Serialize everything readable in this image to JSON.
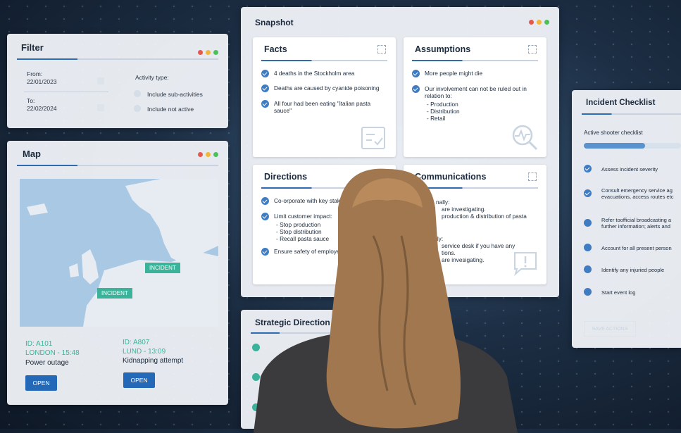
{
  "filter": {
    "title": "Filter",
    "from_label": "From:",
    "from_value": "22/01/2023",
    "to_label": "To:",
    "to_value": "22/02/2024",
    "activity_label": "Activity type:",
    "opt1": "Include sub-activities",
    "opt2": "Include not active"
  },
  "map": {
    "title": "Map",
    "marker1": "INCIDENT",
    "marker2": "INCIDENT",
    "inc1_id": "ID: A101",
    "inc1_loc": "LONDON - 15:48",
    "inc1_type": "Power outage",
    "inc1_btn": "OPEN",
    "inc2_id": "ID: A807",
    "inc2_loc": "LUND - 13:09",
    "inc2_type": "Kidnapping attempt",
    "inc2_btn": "OPEN"
  },
  "snapshot": {
    "title": "Snapshot",
    "facts": {
      "title": "Facts",
      "items": [
        "4 deaths in the Stockholm area",
        "Deaths are caused by cyanide poisoning",
        "All four had been eating \"italian pasta sauce\""
      ]
    },
    "assumptions": {
      "title": "Assumptions",
      "item1": "More people might die",
      "item2": "Our involvement can not be ruled out in relation to:",
      "sub": [
        "-  Production",
        "-  Distribution",
        "-  Retail"
      ]
    },
    "directions": {
      "title": "Directions",
      "item1": "Co-orporate with key stakeh",
      "item2": "Limit customer impact:",
      "sub": [
        "-  Stop production",
        "-  Stop distribution",
        "-  Recall pasta sauce"
      ],
      "item3": "Ensure safety of employe"
    },
    "communications": {
      "title": "Communications",
      "lines": [
        "nally:",
        "are investigating.",
        "production & distribution of pasta",
        "lly:",
        "service desk if you have any",
        "tions.",
        "are invesigating."
      ]
    }
  },
  "strategic": {
    "title": "Strategic Direction"
  },
  "checklist": {
    "title": "Incident Checklist",
    "subtitle": "Active shooter checklist",
    "items": [
      "Assess incident severity",
      "Consult emergency service ag evacuations, access routes etc",
      "Refer toofficial broadcasting a further information; alerts and",
      "Account for all present person",
      "Identify any injuried people",
      "Start event log"
    ],
    "save": "SAVE ACTIONS",
    "progress": 0.6
  }
}
